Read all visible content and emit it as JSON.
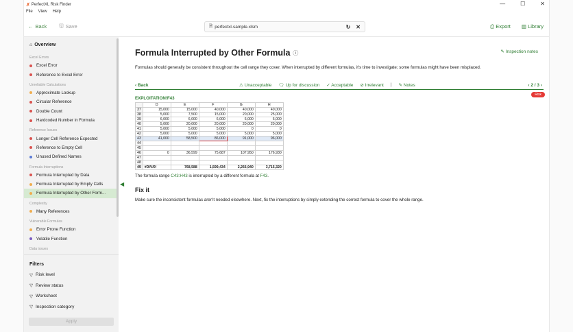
{
  "window": {
    "title": "PerfectXL Risk Finder",
    "menu": [
      "File",
      "View",
      "Help"
    ]
  },
  "toolbar": {
    "back": "Back",
    "save": "Save",
    "file": "perfectxl-sample.xlsm",
    "export": "Export",
    "library": "Library"
  },
  "sidebar": {
    "overview": "Overview",
    "groups": [
      {
        "category": "Excel Errors",
        "items": [
          {
            "label": "Excel Error",
            "color": "#d9534f"
          },
          {
            "label": "Reference to Excel Error",
            "color": "#d9534f"
          }
        ]
      },
      {
        "category": "Unreliable Calculations",
        "items": [
          {
            "label": "Approximate Lookup",
            "color": "#f0ad4e"
          },
          {
            "label": "Circular Reference",
            "color": "#d9534f"
          },
          {
            "label": "Double Count",
            "color": "#d9534f"
          },
          {
            "label": "Hardcoded Number in Formula",
            "color": "#d9534f"
          }
        ]
      },
      {
        "category": "Reference Issues",
        "items": [
          {
            "label": "Longer Cell Reference Expected",
            "color": "#d9534f"
          },
          {
            "label": "Reference to Empty Cell",
            "color": "#d9534f"
          },
          {
            "label": "Unused Defined Names",
            "color": "#5b7bd5"
          }
        ]
      },
      {
        "category": "Formula Interruptions",
        "items": [
          {
            "label": "Formula Interrupted by Data",
            "color": "#d9534f"
          },
          {
            "label": "Formula Interrupted by Empty Cells",
            "color": "#f0ad4e"
          },
          {
            "label": "Formula Interrupted by Other Form...",
            "color": "#f0ad4e"
          }
        ]
      },
      {
        "category": "Complexity",
        "items": [
          {
            "label": "Many References",
            "color": "#f0ad4e"
          }
        ]
      },
      {
        "category": "Vulnerable Formulas",
        "items": [
          {
            "label": "Error Prone Function",
            "color": "#f0ad4e"
          },
          {
            "label": "Volatile Function",
            "color": "#7a5cc0"
          }
        ]
      },
      {
        "category": "Data issues",
        "items": []
      }
    ],
    "active": "Formula Interrupted by Other Form...",
    "filters_title": "Filters",
    "filters": [
      "Risk level",
      "Review status",
      "Worksheet",
      "Inspection category"
    ],
    "apply": "Apply"
  },
  "main": {
    "title": "Formula Interrupted by Other Formula",
    "inspection_notes": "Inspection notes",
    "description": "Formulas should generally be consistent throughout the cell range they cover. When interrupted by different formulas, it's time to investigate; some formulas might have been misplaced.",
    "back": "Back",
    "actions": [
      "Unacceptable",
      "Up for discussion",
      "Acceptable",
      "Irrelevant",
      "Notes"
    ],
    "pager": "2 / 3",
    "risk": "Risk",
    "cell_ref": "EXPLOITATION!F43",
    "columns": [
      "D",
      "E",
      "F",
      "G",
      "H"
    ],
    "rows": [
      {
        "n": "37",
        "cells": [
          "15,000",
          "15,000",
          "40,000",
          "40,000",
          "40,000"
        ]
      },
      {
        "n": "38",
        "cells": [
          "5,000",
          "7,500",
          "15,000",
          "20,000",
          "25,000"
        ]
      },
      {
        "n": "39",
        "cells": [
          "6,000",
          "6,000",
          "6,000",
          "6,000",
          "6,000"
        ]
      },
      {
        "n": "40",
        "cells": [
          "5,000",
          "20,000",
          "20,000",
          "20,000",
          "20,000"
        ]
      },
      {
        "n": "41",
        "cells": [
          "5,000",
          "5,000",
          "5,000",
          "0",
          "0"
        ]
      },
      {
        "n": "42",
        "cells": [
          "5,000",
          "5,000",
          "5,000",
          "5,000",
          "5,000"
        ]
      },
      {
        "n": "43",
        "cells": [
          "41,000",
          "58,500",
          "86,000",
          "91,000",
          "96,000"
        ]
      },
      {
        "n": "44",
        "cells": [
          "",
          "",
          "",
          "",
          ""
        ]
      },
      {
        "n": "45",
        "cells": [
          "",
          "",
          "",
          "",
          ""
        ]
      },
      {
        "n": "46",
        "cells": [
          "0",
          "36,599",
          "75,687",
          "107,950",
          "176,930"
        ]
      },
      {
        "n": "47",
        "cells": [
          "",
          "",
          "",
          "",
          ""
        ]
      },
      {
        "n": "48",
        "cells": [
          "",
          "",
          "",
          "",
          ""
        ]
      },
      {
        "n": "49",
        "cells": [
          "#DIV/0!",
          "768,588",
          "1,599,434",
          "2,266,940",
          "3,715,320"
        ]
      }
    ],
    "note_prefix": "The formula range ",
    "note_range": "C43:H43",
    "note_middle": " is interrupted by a different formula at ",
    "note_cell": "F43",
    "note_suffix": ".",
    "fix_title": "Fix it",
    "fix_text": "Make sure the inconsistent formulas aren't needed elsewhere. Next, fix the interruptions by simply extending the correct formula to cover the whole range."
  }
}
